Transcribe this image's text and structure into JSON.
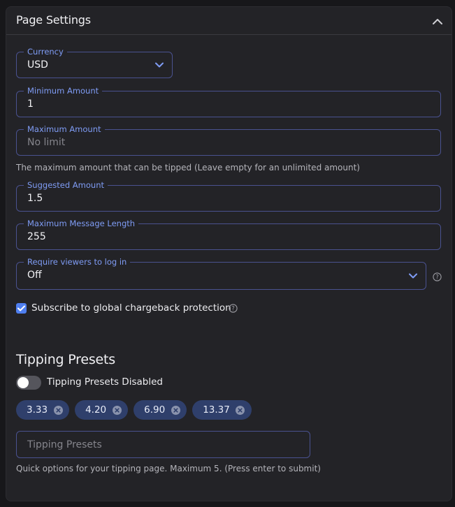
{
  "header": {
    "title": "Page Settings",
    "collapse_icon": "chevron-up-icon"
  },
  "currency": {
    "label": "Currency",
    "value": "USD"
  },
  "minimum_amount": {
    "label": "Minimum Amount",
    "value": "1"
  },
  "maximum_amount": {
    "label": "Maximum Amount",
    "placeholder": "No limit",
    "helper": "The maximum amount that can be tipped (Leave empty for an unlimited amount)"
  },
  "suggested_amount": {
    "label": "Suggested Amount",
    "value": "1.5"
  },
  "max_message_length": {
    "label": "Maximum Message Length",
    "value": "255"
  },
  "require_login": {
    "label": "Require viewers to log in",
    "value": "Off"
  },
  "chargeback": {
    "label": "Subscribe to global chargeback protection",
    "checked": true
  },
  "tipping_presets": {
    "title": "Tipping Presets",
    "toggle_label": "Tipping Presets Disabled",
    "toggle_on": false,
    "chips": [
      "3.33",
      "4.20",
      "6.90",
      "13.37"
    ],
    "input_placeholder": "Tipping Presets",
    "helper": "Quick options for your tipping page. Maximum 5. (Press enter to submit)"
  },
  "colors": {
    "accent": "#7f9cf5",
    "field_border": "#4a5290",
    "chip_bg": "#2f3f6b",
    "checkbox": "#4f7ff0"
  }
}
